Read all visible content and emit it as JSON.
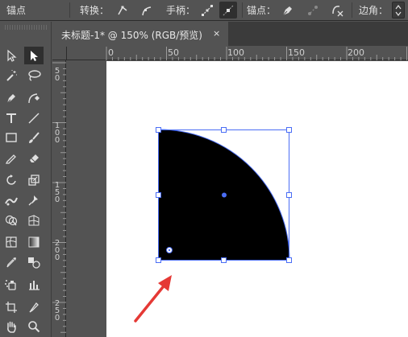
{
  "control_bar": {
    "anchor_label": "锚点",
    "convert_label": "转换：",
    "handle_label": "手柄：",
    "anchors_label": "锚点：",
    "corner_label": "边角："
  },
  "document": {
    "tab_title": "未标题-1* @ 150% (RGB/预览)",
    "close_glyph": "×"
  },
  "rulers": {
    "horizontal": [
      "0",
      "50",
      "100",
      "150",
      "200"
    ],
    "vertical": [
      "50",
      "100",
      "150",
      "200",
      "250"
    ]
  },
  "tools": [
    "selection-tool",
    "direct-selection-tool",
    "magic-wand-tool",
    "lasso-tool",
    "pen-tool",
    "curvature-tool",
    "type-tool",
    "line-segment-tool",
    "rectangle-tool",
    "paintbrush-tool",
    "shaper-tool",
    "eraser-tool",
    "rotate-tool",
    "scale-tool",
    "width-tool",
    "puppet-warp-tool",
    "shape-builder-tool",
    "perspective-grid-tool",
    "mesh-tool",
    "gradient-tool",
    "eyedropper-tool",
    "blend-tool",
    "symbol-sprayer-tool",
    "column-graph-tool",
    "artboard-tool",
    "slice-tool",
    "hand-tool",
    "zoom-tool"
  ],
  "colors": {
    "ui_gray": "#535353",
    "selection_blue": "#4a6df5",
    "shape_fill": "#000000",
    "annotation_arrow": "#e53935"
  }
}
